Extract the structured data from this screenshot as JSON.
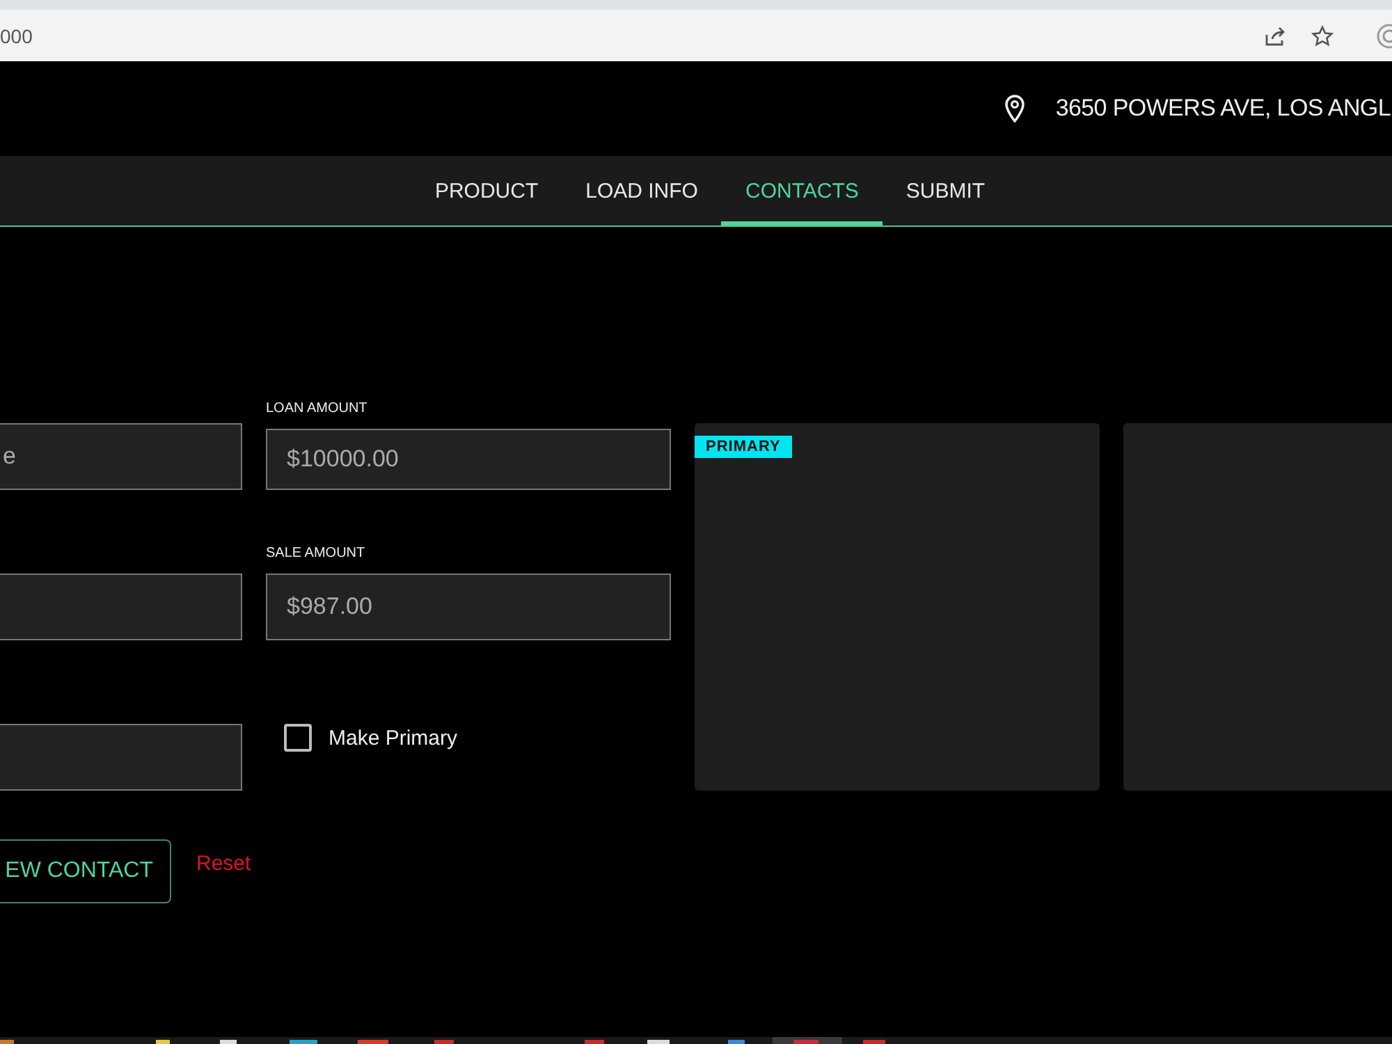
{
  "browser": {
    "url": "000"
  },
  "header": {
    "address": "3650 POWERS AVE, LOS ANGL"
  },
  "nav": {
    "tabs": [
      {
        "label": "PRODUCT",
        "selected": false
      },
      {
        "label": "LOAD INFO",
        "selected": false
      },
      {
        "label": "CONTACTS",
        "selected": true
      },
      {
        "label": "SUBMIT",
        "selected": false
      }
    ]
  },
  "form": {
    "first_field": {
      "value": "e"
    },
    "right_fields": [
      {
        "label": "LOAN AMOUNT",
        "value": "$10000.00"
      },
      {
        "label": "SALE AMOUNT",
        "value": "$987.00"
      }
    ],
    "make_primary": {
      "label": "Make Primary",
      "checked": false
    },
    "add_button": "EW CONTACT",
    "reset": "Reset"
  },
  "cards": [
    {
      "primary": true,
      "badge": "PRIMARY"
    },
    {
      "primary": false
    }
  ]
}
